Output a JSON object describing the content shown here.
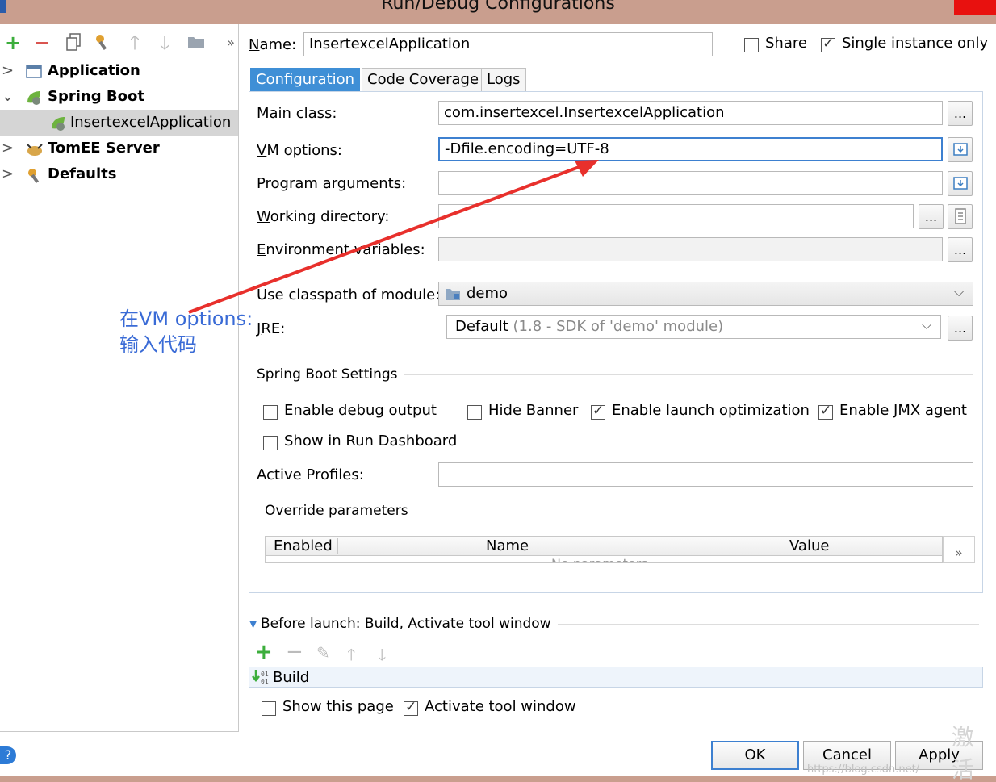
{
  "window": {
    "title": "Run/Debug Configurations"
  },
  "left_toolbar": {
    "icons": [
      "plus-icon",
      "minus-icon",
      "copy-icon",
      "wrench-icon",
      "arrow-up-icon",
      "arrow-down-icon",
      "folder-icon",
      "more-icon"
    ]
  },
  "tree": {
    "items": [
      {
        "label": "Application",
        "icon": "application-icon",
        "expanded": false
      },
      {
        "label": "Spring Boot",
        "icon": "spring-boot-icon",
        "expanded": true
      },
      {
        "label": "InsertexcelApplication",
        "icon": "spring-boot-icon",
        "selected": true
      },
      {
        "label": "TomEE Server",
        "icon": "tomee-icon",
        "expanded": false
      },
      {
        "label": "Defaults",
        "icon": "defaults-icon",
        "expanded": false
      }
    ]
  },
  "header": {
    "name_label": "Name:",
    "name_value": "InsertexcelApplication",
    "share_label": "Share",
    "share_checked": false,
    "single_instance_label": "Single instance only",
    "single_instance_checked": true
  },
  "tabs": [
    {
      "label": "Configuration",
      "active": true
    },
    {
      "label": "Code Coverage",
      "active": false
    },
    {
      "label": "Logs",
      "active": false
    }
  ],
  "config": {
    "main_class_label": "Main class:",
    "main_class_value": "com.insertexcel.InsertexcelApplication",
    "vm_options_label": "VM options:",
    "vm_options_value": "-Dfile.encoding=UTF-8",
    "program_args_label": "Program arguments:",
    "program_args_value": "",
    "working_dir_label": "Working directory:",
    "working_dir_value": "",
    "env_vars_label": "Environment variables:",
    "env_vars_value": "",
    "classpath_label": "Use classpath of module:",
    "classpath_value": "demo",
    "jre_label": "JRE:",
    "jre_value": "Default",
    "jre_hint": "(1.8 - SDK of 'demo' module)",
    "dots": "..."
  },
  "spring_boot": {
    "section_title": "Spring Boot Settings",
    "enable_debug_label": "Enable debug output",
    "enable_debug_checked": false,
    "hide_banner_label": "Hide Banner",
    "hide_banner_checked": false,
    "launch_opt_label": "Enable launch optimization",
    "launch_opt_checked": true,
    "jmx_label": "Enable JMX agent",
    "jmx_checked": true,
    "run_dashboard_label": "Show in Run Dashboard",
    "run_dashboard_checked": false,
    "active_profiles_label": "Active Profiles:",
    "active_profiles_value": ""
  },
  "override": {
    "section_title": "Override parameters",
    "columns": [
      "Enabled",
      "Name",
      "Value"
    ],
    "empty_text": "No parameters",
    "more_label": "»"
  },
  "before_launch": {
    "title": "Before launch: Build, Activate tool window",
    "tasks": [
      "Build"
    ],
    "show_page_label": "Show this page",
    "show_page_checked": false,
    "activate_label": "Activate tool window",
    "activate_checked": true
  },
  "annotation": {
    "line1": "在VM options:",
    "line2": "输入代码",
    "color": "#3a6bd6",
    "arrow_color": "#e8302c"
  },
  "buttons": {
    "ok": "OK",
    "cancel": "Cancel",
    "apply": "Apply",
    "help": "?"
  },
  "watermark": {
    "text": "https://blog.csdn.net/",
    "activate": "激活"
  }
}
